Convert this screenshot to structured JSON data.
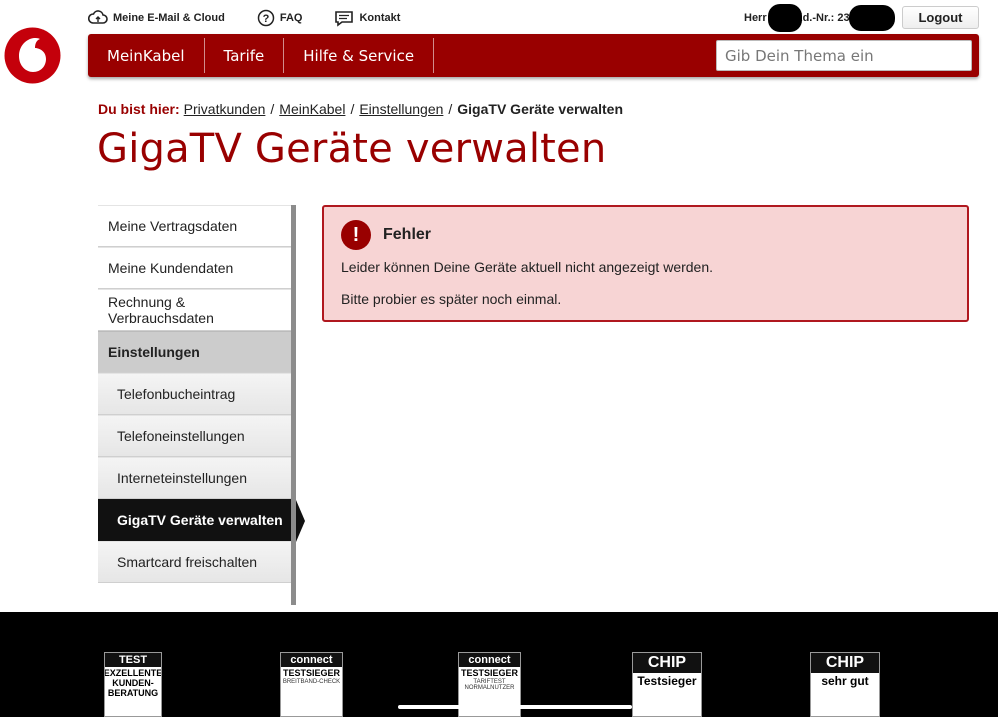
{
  "utility": {
    "mail": "Meine E-Mail & Cloud",
    "faq": "FAQ",
    "contact": "Kontakt"
  },
  "account": {
    "salutation": "Herr",
    "kd_label": "Kd.-Nr.: 232",
    "logout": "Logout"
  },
  "nav": {
    "items": [
      "MeinKabel",
      "Tarife",
      "Hilfe & Service"
    ],
    "search_placeholder": "Gib Dein Thema ein"
  },
  "breadcrumb": {
    "lead": "Du bist hier:",
    "links": [
      "Privatkunden",
      "MeinKabel",
      "Einstellungen"
    ],
    "current": "GigaTV Geräte verwalten"
  },
  "page_title": "GigaTV Geräte verwalten",
  "sidebar": {
    "items": [
      {
        "label": "Meine Vertragsdaten"
      },
      {
        "label": "Meine Kundendaten"
      },
      {
        "label": "Rechnung & Verbrauchsdaten"
      },
      {
        "label": "Einstellungen"
      },
      {
        "label": "Telefonbucheintrag"
      },
      {
        "label": "Telefoneinstellungen"
      },
      {
        "label": "Interneteinstellungen"
      },
      {
        "label": "GigaTV Geräte verwalten"
      },
      {
        "label": "Smartcard freischalten"
      }
    ]
  },
  "error": {
    "icon": "!",
    "title": "Fehler",
    "line1": "Leider können Deine Geräte aktuell nicht angezeigt werden.",
    "line2": "Bitte probier es später noch einmal."
  },
  "footer": {
    "badges": [
      {
        "head": "TEST",
        "text": "EXZELLENTE KUNDEN-BERATUNG"
      },
      {
        "head": "connect",
        "text": "TESTSIEGER",
        "small": "BREITBAND-CHECK"
      },
      {
        "head": "connect",
        "text": "TESTSIEGER",
        "small": "TARIFTEST NORMALNUTZER"
      },
      {
        "head": "CHIP",
        "text": "Testsieger"
      },
      {
        "head": "CHIP",
        "text": "sehr gut"
      }
    ]
  },
  "colors": {
    "brand_red": "#990000",
    "error_bg": "#f7d4d4"
  }
}
